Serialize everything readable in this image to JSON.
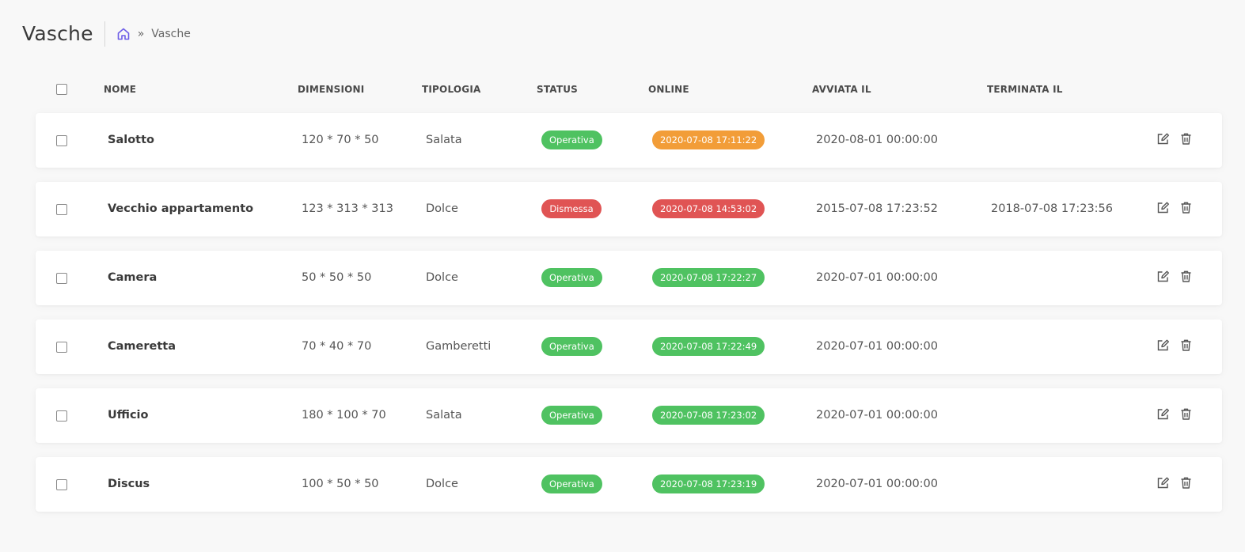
{
  "header": {
    "title": "Vasche",
    "breadcrumb": {
      "current": "Vasche",
      "separator": "»"
    }
  },
  "colors": {
    "accent": "#6c5ce7",
    "operativa": "#4fc261",
    "dismessa": "#e05454",
    "online_ok": "#4fc261",
    "online_warn": "#f29d38",
    "online_err": "#e05454"
  },
  "table": {
    "columns": [
      "NOME",
      "DIMENSIONI",
      "TIPOLOGIA",
      "STATUS",
      "ONLINE",
      "AVVIATA IL",
      "TERMINATA IL"
    ],
    "rows": [
      {
        "name": "Salotto",
        "dimensions": "120 * 70 * 50",
        "type": "Salata",
        "status": "Operativa",
        "status_kind": "ok",
        "online": "2020-07-08 17:11:22",
        "online_kind": "warn",
        "started": "2020-08-01 00:00:00",
        "ended": ""
      },
      {
        "name": "Vecchio appartamento",
        "dimensions": "123 * 313 * 313",
        "type": "Dolce",
        "status": "Dismessa",
        "status_kind": "err",
        "online": "2020-07-08 14:53:02",
        "online_kind": "err",
        "started": "2015-07-08 17:23:52",
        "ended": "2018-07-08 17:23:56"
      },
      {
        "name": "Camera",
        "dimensions": "50 * 50 * 50",
        "type": "Dolce",
        "status": "Operativa",
        "status_kind": "ok",
        "online": "2020-07-08 17:22:27",
        "online_kind": "ok",
        "started": "2020-07-01 00:00:00",
        "ended": ""
      },
      {
        "name": "Cameretta",
        "dimensions": "70 * 40 * 70",
        "type": "Gamberetti",
        "status": "Operativa",
        "status_kind": "ok",
        "online": "2020-07-08 17:22:49",
        "online_kind": "ok",
        "started": "2020-07-01 00:00:00",
        "ended": ""
      },
      {
        "name": "Ufficio",
        "dimensions": "180 * 100 * 70",
        "type": "Salata",
        "status": "Operativa",
        "status_kind": "ok",
        "online": "2020-07-08 17:23:02",
        "online_kind": "ok",
        "started": "2020-07-01 00:00:00",
        "ended": ""
      },
      {
        "name": "Discus",
        "dimensions": "100 * 50 * 50",
        "type": "Dolce",
        "status": "Operativa",
        "status_kind": "ok",
        "online": "2020-07-08 17:23:19",
        "online_kind": "ok",
        "started": "2020-07-01 00:00:00",
        "ended": ""
      }
    ]
  }
}
